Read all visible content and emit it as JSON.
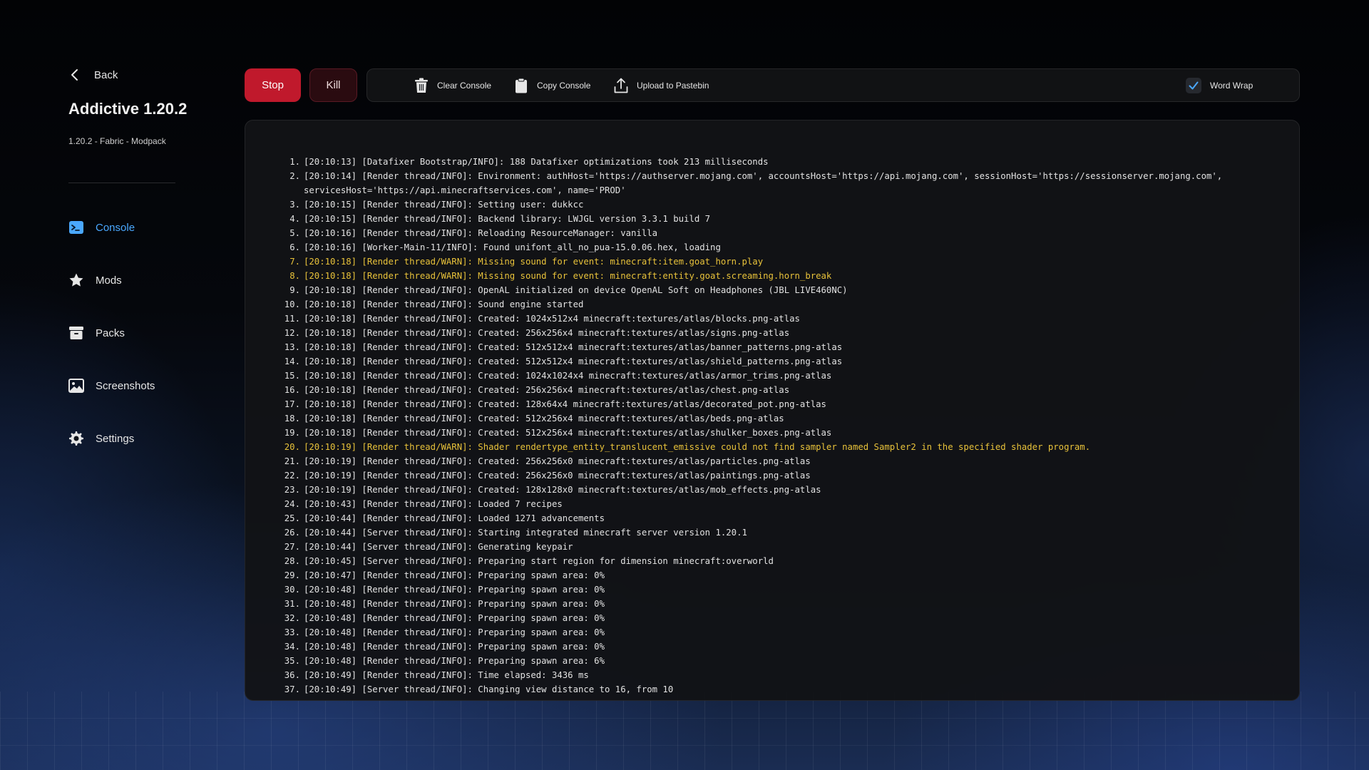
{
  "nav": {
    "back_label": "Back",
    "instance_title": "Addictive 1.20.2",
    "instance_subtitle": "1.20.2 - Fabric - Modpack",
    "items": [
      {
        "label": "Console",
        "icon": "terminal-icon",
        "active": true
      },
      {
        "label": "Mods",
        "icon": "star-icon"
      },
      {
        "label": "Packs",
        "icon": "archive-icon"
      },
      {
        "label": "Screenshots",
        "icon": "image-icon"
      },
      {
        "label": "Settings",
        "icon": "gear-icon"
      }
    ]
  },
  "toolbar": {
    "stop_label": "Stop",
    "kill_label": "Kill",
    "clear_label": "Clear Console",
    "copy_label": "Copy Console",
    "upload_label": "Upload to Pastebin",
    "wordwrap_label": "Word Wrap",
    "wordwrap_checked": true
  },
  "colors": {
    "accent": "#4aa8ff",
    "stop": "#c0192c",
    "warn": "#e8c23a"
  },
  "console": {
    "lines": [
      {
        "n": "1.",
        "text": "[20:10:13] [Datafixer Bootstrap/INFO]: 188 Datafixer optimizations took 213 milliseconds"
      },
      {
        "n": "2.",
        "text": "[20:10:14] [Render thread/INFO]: Environment: authHost='https://authserver.mojang.com', accountsHost='https://api.mojang.com', sessionHost='https://sessionserver.mojang.com', servicesHost='https://api.minecraftservices.com', name='PROD'"
      },
      {
        "n": "3.",
        "text": "[20:10:15] [Render thread/INFO]: Setting user: dukkcc"
      },
      {
        "n": "4.",
        "text": "[20:10:15] [Render thread/INFO]: Backend library: LWJGL version 3.3.1 build 7"
      },
      {
        "n": "5.",
        "text": "[20:10:16] [Render thread/INFO]: Reloading ResourceManager: vanilla"
      },
      {
        "n": "6.",
        "text": "[20:10:16] [Worker-Main-11/INFO]: Found unifont_all_no_pua-15.0.06.hex, loading"
      },
      {
        "n": "7.",
        "text": "[20:10:18] [Render thread/WARN]: Missing sound for event: minecraft:item.goat_horn.play",
        "warn": true
      },
      {
        "n": "8.",
        "text": "[20:10:18] [Render thread/WARN]: Missing sound for event: minecraft:entity.goat.screaming.horn_break",
        "warn": true
      },
      {
        "n": "9.",
        "text": "[20:10:18] [Render thread/INFO]: OpenAL initialized on device OpenAL Soft on Headphones (JBL LIVE460NC)"
      },
      {
        "n": "10.",
        "text": "[20:10:18] [Render thread/INFO]: Sound engine started"
      },
      {
        "n": "11.",
        "text": "[20:10:18] [Render thread/INFO]: Created: 1024x512x4 minecraft:textures/atlas/blocks.png-atlas"
      },
      {
        "n": "12.",
        "text": "[20:10:18] [Render thread/INFO]: Created: 256x256x4 minecraft:textures/atlas/signs.png-atlas"
      },
      {
        "n": "13.",
        "text": "[20:10:18] [Render thread/INFO]: Created: 512x512x4 minecraft:textures/atlas/banner_patterns.png-atlas"
      },
      {
        "n": "14.",
        "text": "[20:10:18] [Render thread/INFO]: Created: 512x512x4 minecraft:textures/atlas/shield_patterns.png-atlas"
      },
      {
        "n": "15.",
        "text": "[20:10:18] [Render thread/INFO]: Created: 1024x1024x4 minecraft:textures/atlas/armor_trims.png-atlas"
      },
      {
        "n": "16.",
        "text": "[20:10:18] [Render thread/INFO]: Created: 256x256x4 minecraft:textures/atlas/chest.png-atlas"
      },
      {
        "n": "17.",
        "text": "[20:10:18] [Render thread/INFO]: Created: 128x64x4 minecraft:textures/atlas/decorated_pot.png-atlas"
      },
      {
        "n": "18.",
        "text": "[20:10:18] [Render thread/INFO]: Created: 512x256x4 minecraft:textures/atlas/beds.png-atlas"
      },
      {
        "n": "19.",
        "text": "[20:10:18] [Render thread/INFO]: Created: 512x256x4 minecraft:textures/atlas/shulker_boxes.png-atlas"
      },
      {
        "n": "20.",
        "text": "[20:10:19] [Render thread/WARN]: Shader rendertype_entity_translucent_emissive could not find sampler named Sampler2 in the specified shader program.",
        "warn": true
      },
      {
        "n": "21.",
        "text": "[20:10:19] [Render thread/INFO]: Created: 256x256x0 minecraft:textures/atlas/particles.png-atlas"
      },
      {
        "n": "22.",
        "text": "[20:10:19] [Render thread/INFO]: Created: 256x256x0 minecraft:textures/atlas/paintings.png-atlas"
      },
      {
        "n": "23.",
        "text": "[20:10:19] [Render thread/INFO]: Created: 128x128x0 minecraft:textures/atlas/mob_effects.png-atlas"
      },
      {
        "n": "24.",
        "text": "[20:10:43] [Render thread/INFO]: Loaded 7 recipes"
      },
      {
        "n": "25.",
        "text": "[20:10:44] [Render thread/INFO]: Loaded 1271 advancements"
      },
      {
        "n": "26.",
        "text": "[20:10:44] [Server thread/INFO]: Starting integrated minecraft server version 1.20.1"
      },
      {
        "n": "27.",
        "text": "[20:10:44] [Server thread/INFO]: Generating keypair"
      },
      {
        "n": "28.",
        "text": "[20:10:45] [Server thread/INFO]: Preparing start region for dimension minecraft:overworld"
      },
      {
        "n": "29.",
        "text": "[20:10:47] [Render thread/INFO]: Preparing spawn area: 0%"
      },
      {
        "n": "30.",
        "text": "[20:10:48] [Render thread/INFO]: Preparing spawn area: 0%"
      },
      {
        "n": "31.",
        "text": "[20:10:48] [Render thread/INFO]: Preparing spawn area: 0%"
      },
      {
        "n": "32.",
        "text": "[20:10:48] [Render thread/INFO]: Preparing spawn area: 0%"
      },
      {
        "n": "33.",
        "text": "[20:10:48] [Render thread/INFO]: Preparing spawn area: 0%"
      },
      {
        "n": "34.",
        "text": "[20:10:48] [Render thread/INFO]: Preparing spawn area: 0%"
      },
      {
        "n": "35.",
        "text": "[20:10:48] [Render thread/INFO]: Preparing spawn area: 6%"
      },
      {
        "n": "36.",
        "text": "[20:10:49] [Render thread/INFO]: Time elapsed: 3436 ms"
      },
      {
        "n": "37.",
        "text": "[20:10:49] [Server thread/INFO]: Changing view distance to 16, from 10"
      }
    ]
  }
}
